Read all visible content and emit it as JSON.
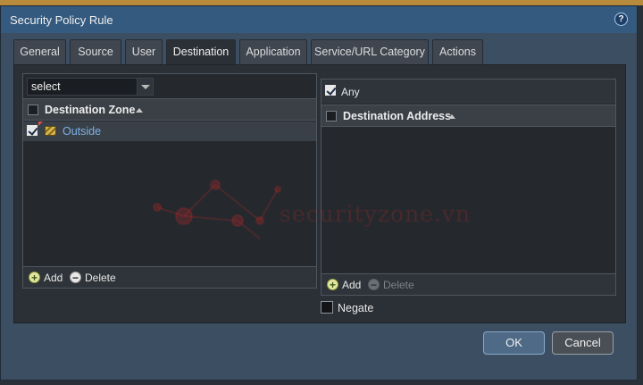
{
  "dialog": {
    "title": "Security Policy Rule",
    "help_icon": "question-icon",
    "help_glyph": "?"
  },
  "tabs": [
    {
      "label": "General",
      "active": false
    },
    {
      "label": "Source",
      "active": false
    },
    {
      "label": "User",
      "active": false
    },
    {
      "label": "Destination",
      "active": true
    },
    {
      "label": "Application",
      "active": false
    },
    {
      "label": "Service/URL Category",
      "active": false
    },
    {
      "label": "Actions",
      "active": false
    }
  ],
  "zone_panel": {
    "select_value": "select",
    "header": "Destination Zone",
    "rows": [
      {
        "label": "Outside",
        "checked": true,
        "icon": "zone-icon"
      }
    ],
    "add_label": "Add",
    "delete_label": "Delete",
    "add_glyph": "+",
    "delete_glyph": "−"
  },
  "address_panel": {
    "any_label": "Any",
    "any_checked": true,
    "header": "Destination Address",
    "add_label": "Add",
    "delete_label": "Delete",
    "add_glyph": "+",
    "delete_glyph": "−",
    "delete_disabled": true
  },
  "negate": {
    "label": "Negate",
    "checked": false
  },
  "buttons": {
    "ok": "OK",
    "cancel": "Cancel"
  },
  "watermark": "securityzone.vn",
  "colors": {
    "title_bar": "#345a7f",
    "dialog_bg": "#3c4e61",
    "link_text": "#7ab2e6",
    "ok_button": "#4e6a86"
  }
}
